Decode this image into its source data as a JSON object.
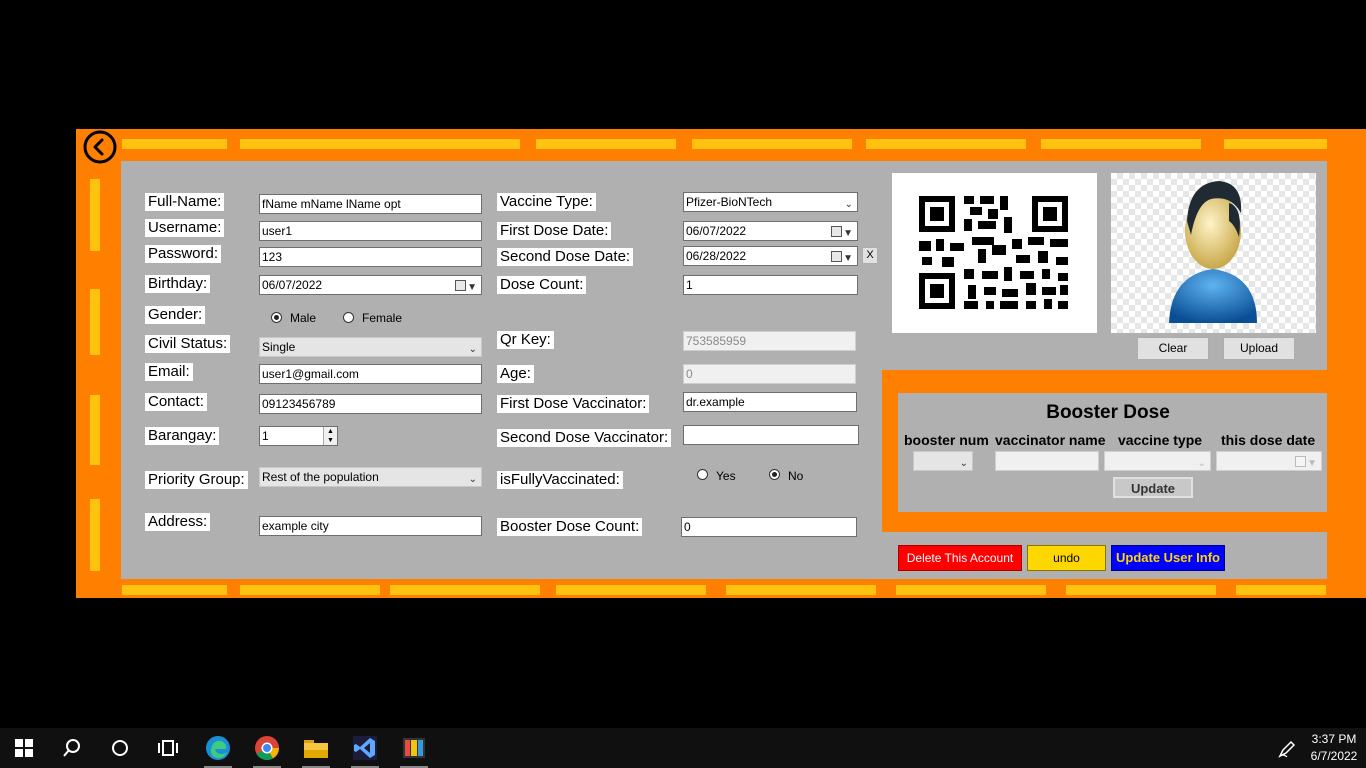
{
  "form": {
    "fullname_label": "Full-Name:",
    "fullname_value": "fName mName lName opt",
    "username_label": "Username:",
    "username_value": "user1",
    "password_label": "Password:",
    "password_value": "123",
    "birthday_label": "Birthday:",
    "birthday_value": "06/07/2022",
    "gender_label": "Gender:",
    "gender_male": "Male",
    "gender_female": "Female",
    "gender_selected": "Male",
    "civil_label": "Civil Status:",
    "civil_value": "Single",
    "email_label": "Email:",
    "email_value": "user1@gmail.com",
    "contact_label": "Contact:",
    "contact_value": "09123456789",
    "barangay_label": "Barangay:",
    "barangay_value": "1",
    "priority_label": "Priority Group:",
    "priority_value": "Rest of the population",
    "address_label": "Address:",
    "address_value": "example city",
    "vaccine_type_label": "Vaccine Type:",
    "vaccine_type_value": "Pfizer-BioNTech",
    "first_dose_date_label": "First Dose Date:",
    "first_dose_date_value": "06/07/2022",
    "second_dose_date_label": "Second Dose Date:",
    "second_dose_date_value": "06/28/2022",
    "second_dose_clear": "X",
    "dose_count_label": "Dose Count:",
    "dose_count_value": "1",
    "qr_key_label": "Qr Key:",
    "qr_key_value": "753585959",
    "age_label": "Age:",
    "age_value": "0",
    "first_vaccinator_label": "First Dose Vaccinator:",
    "first_vaccinator_value": "dr.example",
    "second_vaccinator_label": "Second Dose Vaccinator:",
    "second_vaccinator_value": "",
    "fully_vaccinated_label": "isFullyVaccinated:",
    "fully_yes": "Yes",
    "fully_no": "No",
    "fully_selected": "No",
    "booster_count_label": "Booster Dose Count:",
    "booster_count_value": "0"
  },
  "photo": {
    "clear_label": "Clear",
    "upload_label": "Upload"
  },
  "booster": {
    "title": "Booster Dose",
    "col_num": "booster num",
    "col_vaccinator": "vaccinator name",
    "col_type": "vaccine type",
    "col_date": "this dose date",
    "update_label": "Update"
  },
  "actions": {
    "delete_label": "Delete This Account",
    "undo_label": "undo",
    "update_info_label": "Update User Info"
  },
  "colors": {
    "frame": "#ff7f00",
    "dash": "#ffc20e",
    "panel": "#b0b0b0",
    "delete": "#ff0000",
    "undo": "#ffd700",
    "update_info": "#0000ff"
  },
  "taskbar": {
    "time": "3:37 PM",
    "date": "6/7/2022",
    "icons": [
      "windows-start-icon",
      "search-icon",
      "cortana-icon",
      "task-view-icon",
      "edge-icon",
      "chrome-icon",
      "file-explorer-icon",
      "visual-studio-icon",
      "app-icon"
    ]
  }
}
